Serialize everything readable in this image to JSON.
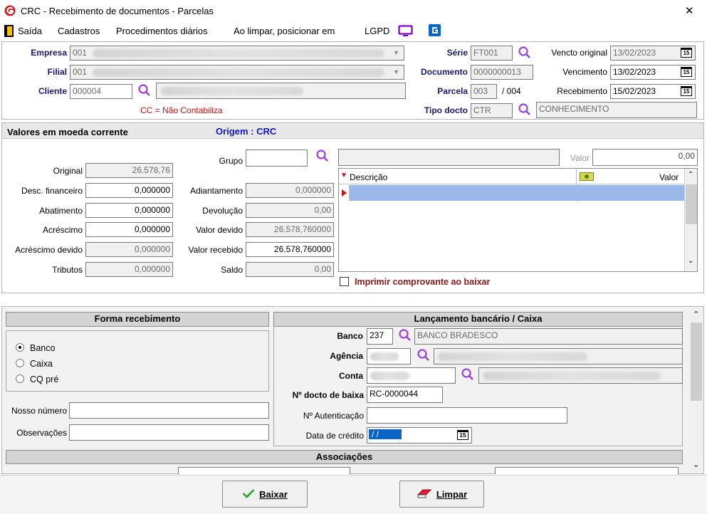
{
  "window": {
    "title": "CRC - Recebimento de documentos - Parcelas",
    "close_glyph": "✕"
  },
  "menu": {
    "items": [
      "Saída",
      "Cadastros",
      "Procedimentos diários",
      "Ao limpar, posicionar em",
      "LGPD"
    ]
  },
  "header": {
    "empresa_label": "Empresa",
    "empresa_value": "001",
    "filial_label": "Filial",
    "filial_value": "001",
    "cliente_label": "Cliente",
    "cliente_value": "000004",
    "cc_note": "CC = Não Contabiliza",
    "serie_label": "Série",
    "serie_value": "FT001",
    "documento_label": "Documento",
    "documento_value": "0000000013",
    "parcela_label": "Parcela",
    "parcela_value": "003",
    "parcela_total": "/ 004",
    "tipo_label": "Tipo docto",
    "tipo_value": "CTR",
    "tipo_desc": "CONHECIMENTO",
    "vencto_original_label": "Vencto original",
    "vencto_original_value": "13/02/2023",
    "vencimento_label": "Vencimento",
    "vencimento_value": "13/02/2023",
    "recebimento_label": "Recebimento",
    "recebimento_value": "15/02/2023"
  },
  "valores": {
    "section_title": "Valores em moeda corrente",
    "origem": "Origem : CRC",
    "original_label": "Original",
    "original_value": "26.578,76",
    "desc_fin_label": "Desc. financeiro",
    "desc_fin_value": "0,000000",
    "abatimento_label": "Abatimento",
    "abatimento_value": "0,000000",
    "acrescimo_label": "Acréscimo",
    "acrescimo_value": "0,000000",
    "acrescimo_devido_label": "Acréscimo devido",
    "acrescimo_devido_value": "0,000000",
    "tributos_label": "Tributos",
    "tributos_value": "0,000000",
    "grupo_label": "Grupo",
    "grupo_value": "",
    "adiantamento_label": "Adiantamento",
    "adiantamento_value": "0,000000",
    "devolucao_label": "Devolução",
    "devolucao_value": "0,00",
    "valor_devido_label": "Valor devido",
    "valor_devido_value": "26.578,760000",
    "valor_recebido_label": "Valor recebido",
    "valor_recebido_value": "26.578,760000",
    "saldo_label": "Saldo",
    "saldo_value": "0,00",
    "valor_label": "Valor",
    "valor_value": "0,00",
    "grid_col_descricao": "Descrição",
    "grid_col_valor": "Valor",
    "imprimir_label": "Imprimir comprovante ao baixar"
  },
  "forma": {
    "title": "Forma recebimento",
    "options": [
      "Banco",
      "Caixa",
      "CQ pré"
    ],
    "selected": "Banco",
    "nosso_numero_label": "Nosso número",
    "observacoes_label": "Observações"
  },
  "lancamento": {
    "title": "Lançamento bancário / Caixa",
    "banco_label": "Banco",
    "banco_value": "237",
    "banco_name": "BANCO BRADESCO",
    "agencia_label": "Agência",
    "conta_label": "Conta",
    "docto_baixa_label": "Nº docto de baixa",
    "docto_baixa_value": "RC-0000044",
    "autenticacao_label": "Nº Autenticação",
    "data_credito_label": "Data de crédito",
    "data_credito_value": " / /"
  },
  "associacoes": {
    "title": "Associações"
  },
  "buttons": {
    "baixar": "Baixar",
    "limpar": "Limpar"
  },
  "colors": {
    "accent_red": "#cc1111",
    "label_blue": "#1a1a6e",
    "origem_blue": "#1414c8",
    "selection_blue": "#0a64c8",
    "grid_row_blue": "#9ab8e8"
  }
}
